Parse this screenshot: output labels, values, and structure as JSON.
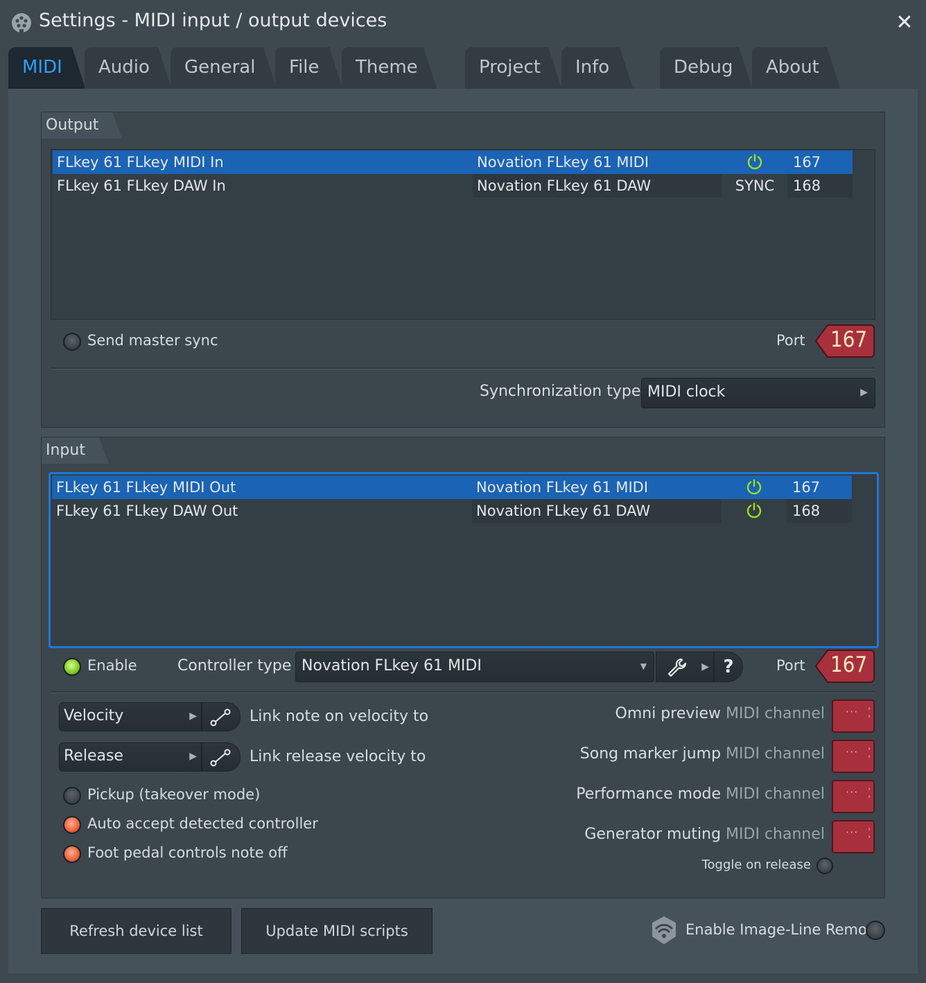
{
  "window": {
    "title": "Settings - MIDI input / output devices",
    "close_label": "✕"
  },
  "tabs": [
    {
      "label": "MIDI",
      "active": true
    },
    {
      "label": "Audio"
    },
    {
      "label": "General"
    },
    {
      "label": "File"
    },
    {
      "label": "Theme"
    },
    {
      "label": "Project"
    },
    {
      "label": "Info"
    },
    {
      "label": "Debug"
    },
    {
      "label": "About"
    }
  ],
  "output": {
    "title": "Output",
    "rows": [
      {
        "name": "FLkey 61 FLkey MIDI In",
        "controller": "Novation FLkey 61 MIDI",
        "status": "power",
        "port": "167",
        "selected": true
      },
      {
        "name": "FLkey 61 FLkey DAW In",
        "controller": "Novation FLkey 61 DAW",
        "status": "SYNC",
        "port": "168"
      }
    ],
    "send_master_sync_label": "Send master sync",
    "port_label": "Port",
    "port_value": "167",
    "sync_type_label": "Synchronization type",
    "sync_type_value": "MIDI clock"
  },
  "input": {
    "title": "Input",
    "rows": [
      {
        "name": "FLkey 61 FLkey MIDI Out",
        "controller": "Novation FLkey 61 MIDI",
        "status": "power",
        "port": "167",
        "selected": true
      },
      {
        "name": "FLkey 61 FLkey DAW Out",
        "controller": "Novation FLkey 61 DAW",
        "status": "power",
        "port": "168"
      }
    ],
    "enable_label": "Enable",
    "controller_type_label": "Controller type",
    "controller_type_value": "Novation FLkey 61 MIDI",
    "help_label": "?",
    "port_label": "Port",
    "port_value": "167",
    "velocity_select": "Velocity",
    "velocity_link_label": "Link note on velocity to",
    "release_select": "Release",
    "release_link_label": "Link release velocity to",
    "pickup_label": "Pickup (takeover mode)",
    "auto_accept_label": "Auto accept detected controller",
    "foot_pedal_label": "Foot pedal controls note off",
    "channels": [
      {
        "name": "Omni preview",
        "suffix": "MIDI channel",
        "value": "···"
      },
      {
        "name": "Song marker jump",
        "suffix": "MIDI channel",
        "value": "···"
      },
      {
        "name": "Performance mode",
        "suffix": "MIDI channel",
        "value": "···"
      },
      {
        "name": "Generator muting",
        "suffix": "MIDI channel",
        "value": "···"
      }
    ],
    "toggle_on_release_label": "Toggle on release"
  },
  "footer": {
    "refresh_label": "Refresh device list",
    "update_scripts_label": "Update MIDI scripts",
    "remote_label": "Enable Image-Line Remote"
  },
  "colors": {
    "accent": "#2aa0ff",
    "selection": "#1b63b4",
    "power_icon": "#9be021",
    "port_badge": "#a8303d"
  },
  "icons": {
    "title": "midi-plug-icon",
    "power": "power-icon",
    "wrench": "wrench-icon",
    "link": "link-icon",
    "remote": "wifi-shield-icon"
  }
}
